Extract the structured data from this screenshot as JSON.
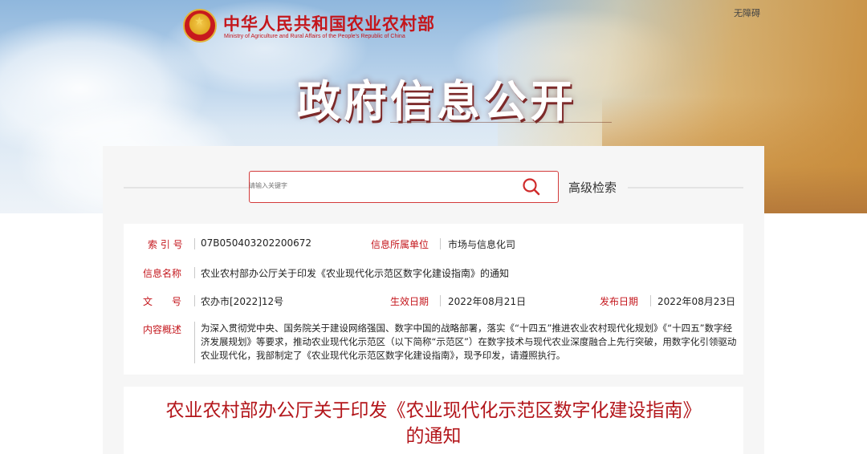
{
  "header": {
    "ministry_cn": "中华人民共和国农业农村部",
    "ministry_en": "Ministry of Agriculture and Rural Affairs of the People's Republic of China",
    "accessibility_link": "无障碍",
    "hero_title": "政府信息公开",
    "emblem_icon": "national-emblem-icon"
  },
  "search": {
    "placeholder": "请输入关键字",
    "advanced_label": "高级检索",
    "icon": "search-icon"
  },
  "info": {
    "index_label": "索 引 号",
    "index_value": "07B050403202200672",
    "unit_label": "信息所属单位",
    "unit_value": "市场与信息化司",
    "name_label": "信息名称",
    "name_value": "农业农村部办公厅关于印发《农业现代化示范区数字化建设指南》的通知",
    "doc_no_label": "文　　号",
    "doc_no_value": "农办市[2022]12号",
    "effective_label": "生效日期",
    "effective_value": "2022年08月21日",
    "publish_label": "发布日期",
    "publish_value": "2022年08月23日",
    "summary_label": "内容概述",
    "summary_value": "为深入贯彻党中央、国务院关于建设网络强国、数字中国的战略部署，落实《“十四五”推进农业农村现代化规划》《“十四五”数字经济发展规划》等要求，推动农业现代化示范区（以下简称“示范区”）在数字技术与现代农业深度融合上先行突破，用数字化引领驱动农业现代化，我部制定了《农业现代化示范区数字化建设指南》，现予印发，请遵照执行。"
  },
  "document": {
    "title_line1": "农业农村部办公厅关于印发《农业现代化示范区数字化建设指南》",
    "title_line2": "的通知"
  },
  "colors": {
    "accent_red": "#c4161c",
    "title_red": "#b3161b",
    "card_bg": "#f6f6f6"
  }
}
